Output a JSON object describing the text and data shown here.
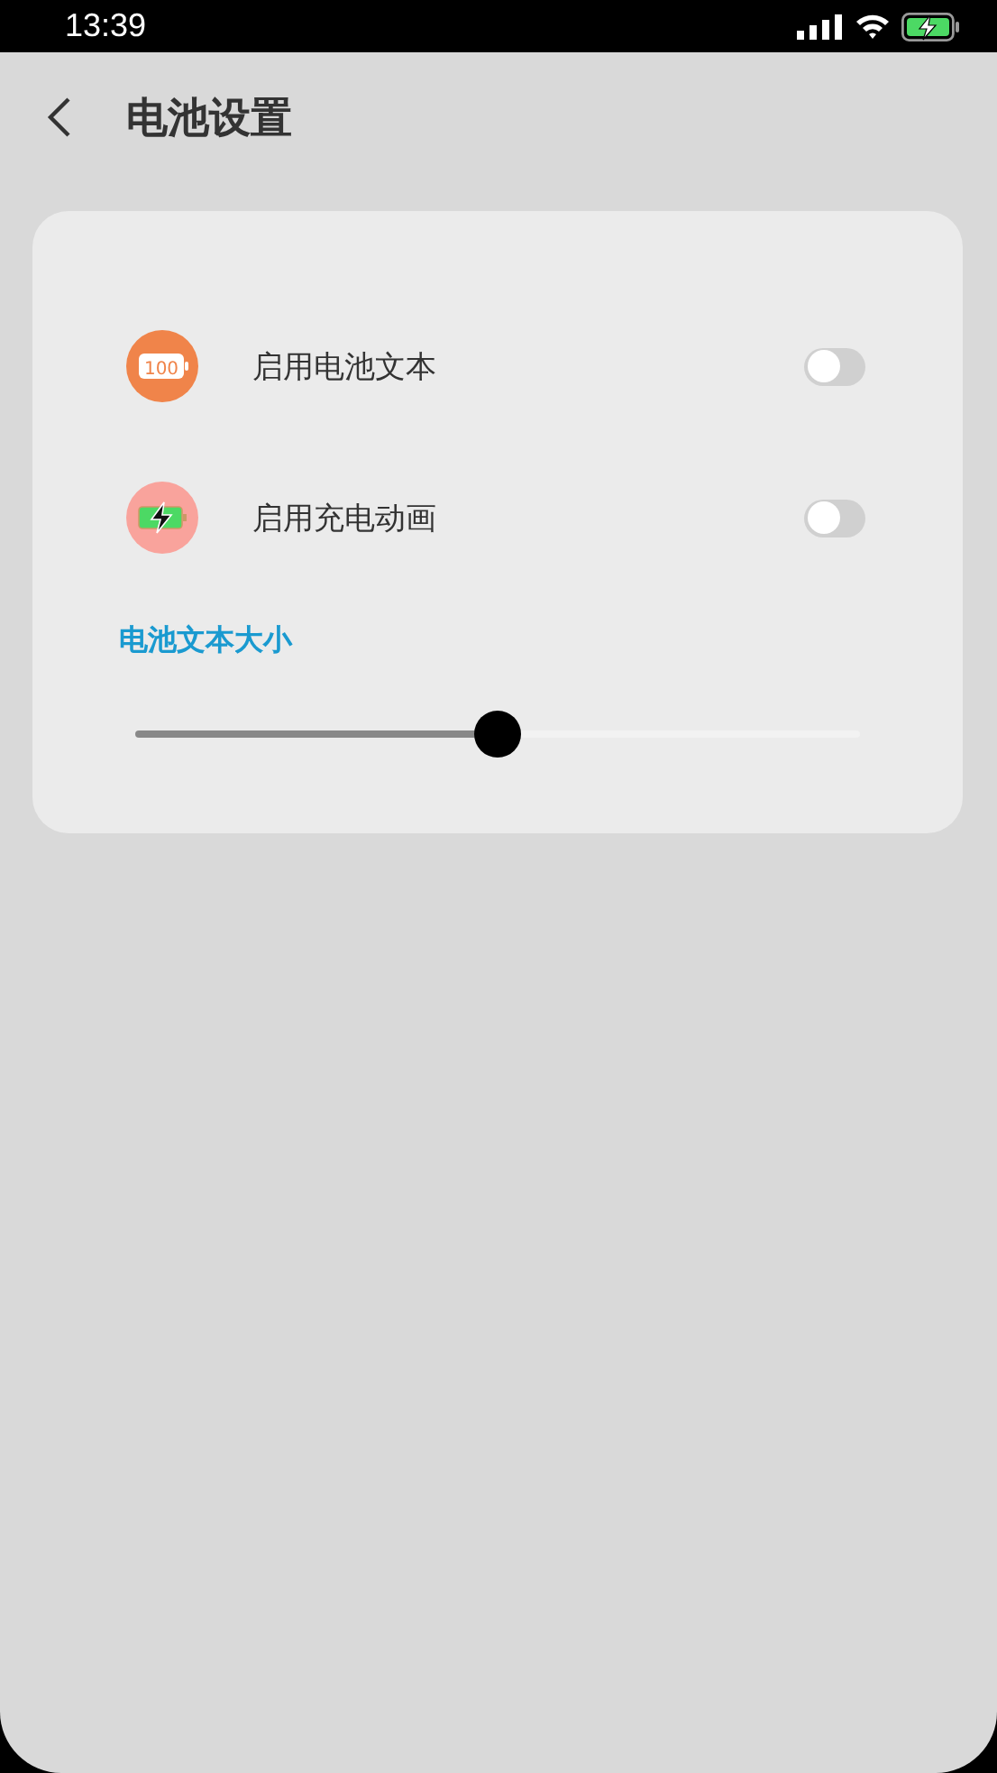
{
  "status_bar": {
    "time": "13:39",
    "charging": true
  },
  "header": {
    "title": "电池设置"
  },
  "settings": [
    {
      "kind": "text",
      "label": "启用电池文本",
      "icon_text": "100",
      "on": false
    },
    {
      "kind": "charge",
      "label": "启用充电动画",
      "on": false
    }
  ],
  "slider": {
    "label": "电池文本大小",
    "level": 0.5
  }
}
